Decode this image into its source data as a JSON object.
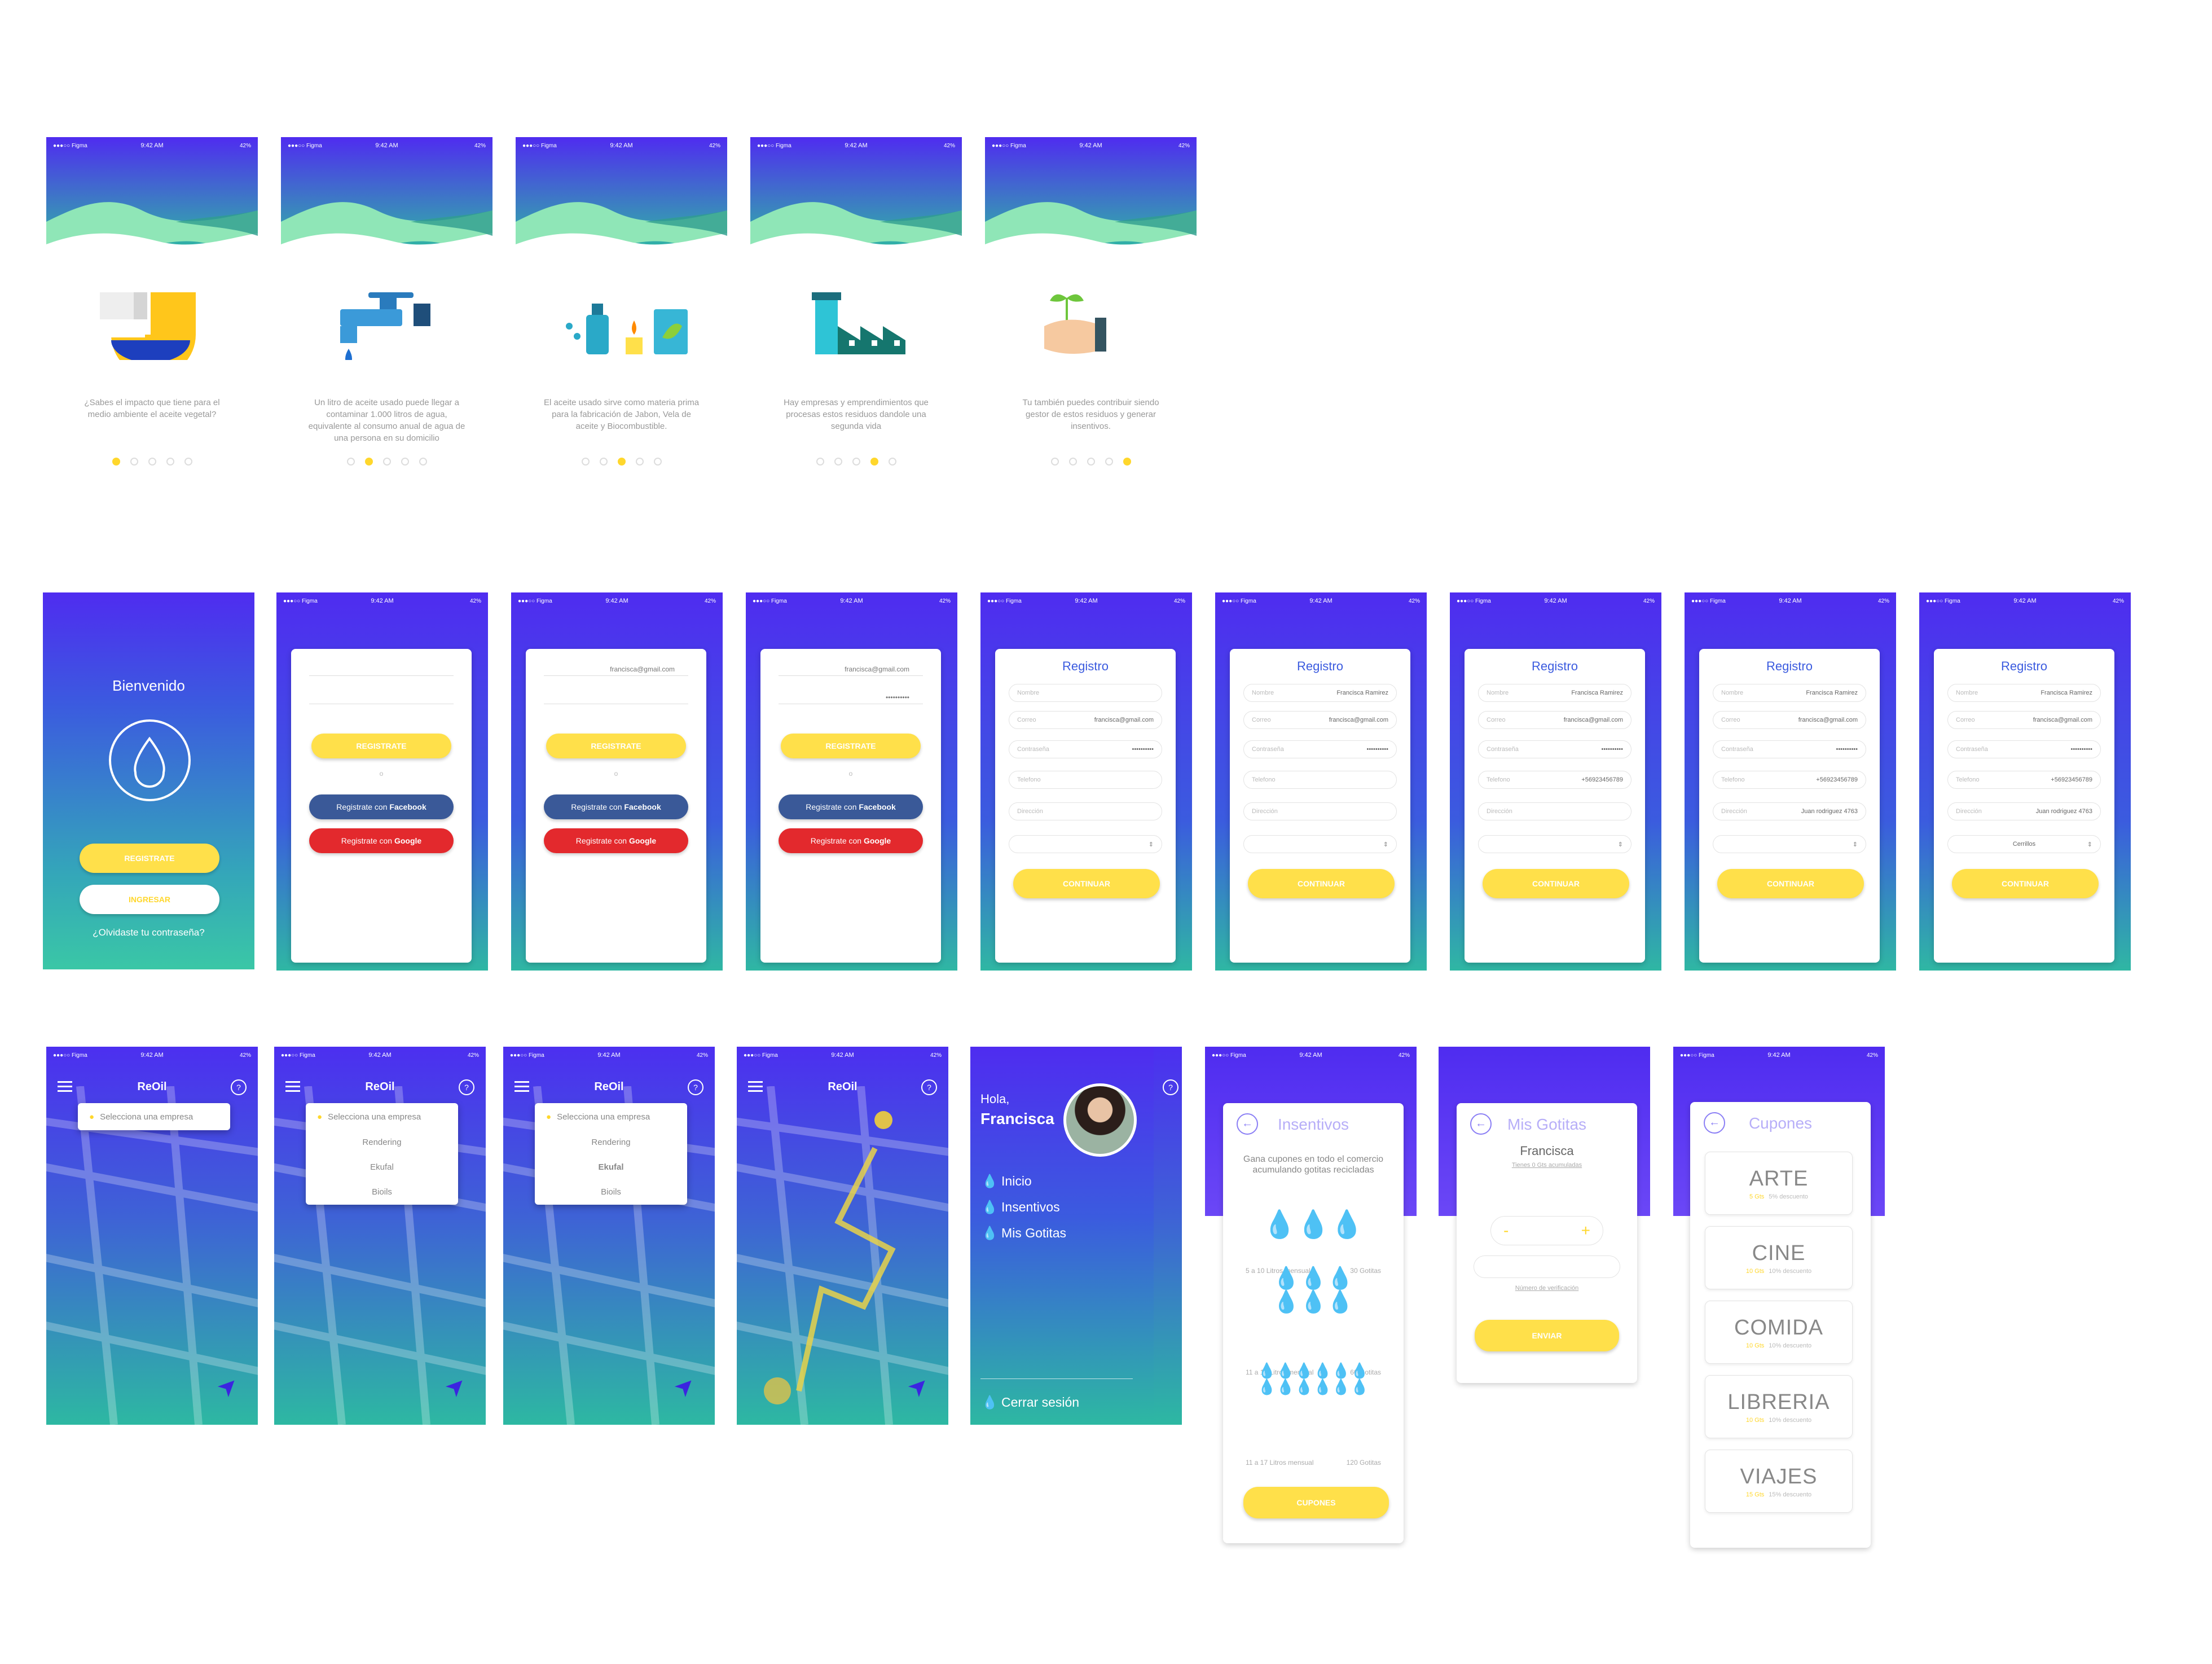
{
  "status": {
    "carrier": "●●●○○ Figma",
    "time": "9:42 AM",
    "battery": "42%"
  },
  "onboarding": [
    {
      "text": "¿Sabes el impacto que tiene para el medio ambiente el aceite vegetal?",
      "active": 0
    },
    {
      "text": "Un litro de aceite usado puede llegar a contaminar 1.000 litros de agua, equivalente al consumo anual de agua de una persona en su domicilio",
      "active": 1
    },
    {
      "text": "El aceite usado sirve como materia prima para la fabricación de Jabon, Vela de aceite y Biocombustible.",
      "active": 2
    },
    {
      "text": "Hay empresas y emprendimientos que procesas estos residuos dandole una segunda vida",
      "active": 3
    },
    {
      "text": "Tu también puedes contribuir siendo gestor de estos residuos y generar  insentivos.",
      "active": 4
    }
  ],
  "welcome": {
    "title": "Bienvenido",
    "register": "REGISTRATE",
    "login": "INGRESAR",
    "forgot": "¿Olvidaste tu contraseña?"
  },
  "signup": {
    "email": "francisca@gmail.com",
    "password": "••••••••••",
    "register": "REGISTRATE",
    "or": "o",
    "fb_pre": "Registrate con ",
    "fb": "Facebook",
    "gg_pre": "Registrate con ",
    "gg": "Google"
  },
  "registro": {
    "title": "Registro",
    "labels": [
      "Nombre",
      "Correo",
      "Contraseña",
      "Telefono",
      "Dirección"
    ],
    "name": "Francisca Ramirez",
    "email": "francisca@gmail.com",
    "password": "••••••••••",
    "phone": "+56923456789",
    "address": "Juan rodriguez 4763",
    "comuna": "Cerrillos",
    "continue": "CONTINUAR"
  },
  "map": {
    "brand": "ReOil",
    "select": "Selecciona una empresa",
    "options": [
      "Rendering",
      "Ekufal",
      "Bioils"
    ]
  },
  "menu": {
    "hello": "Hola,",
    "name": "Francisca",
    "items": [
      "Inicio",
      "Insentivos",
      "Mis Gotitas"
    ],
    "logout": "Cerrar sesión"
  },
  "insentivos": {
    "title": "Insentivos",
    "desc": "Gana cupones en todo el comercio acumulando gotitas recicladas",
    "rows": [
      [
        "5 a 10  Litros mensual",
        "30 Gotitas"
      ],
      [
        "11 a 17  Litros mensual",
        "60 Gotitas"
      ],
      [
        "11 a 17  Litros mensual",
        "120 Gotitas"
      ]
    ],
    "button": "CUPONES"
  },
  "gotitas": {
    "title": "Mis Gotitas",
    "name": "Francisca",
    "sub": "Tienes 0 Gts acumuladas",
    "minus": "-",
    "plus": "+",
    "verify": "Número de verificación",
    "button": "ENVIAR"
  },
  "cupones": {
    "title": "Cupones",
    "items": [
      [
        "ARTE",
        "5 Gts",
        "5% descuento"
      ],
      [
        "CINE",
        "10 Gts",
        "10% descuento"
      ],
      [
        "COMIDA",
        "10 Gts",
        "10% descuento"
      ],
      [
        "LIBRERIA",
        "10 Gts",
        "10% descuento"
      ],
      [
        "VIAJES",
        "15 Gts",
        "15% descuento"
      ]
    ]
  },
  "colors": {
    "blue": "#4f2cf0",
    "teal": "#3ac7a6",
    "yellow": "#ffe04a",
    "facebook": "#3a5998",
    "google": "#e3292d"
  }
}
